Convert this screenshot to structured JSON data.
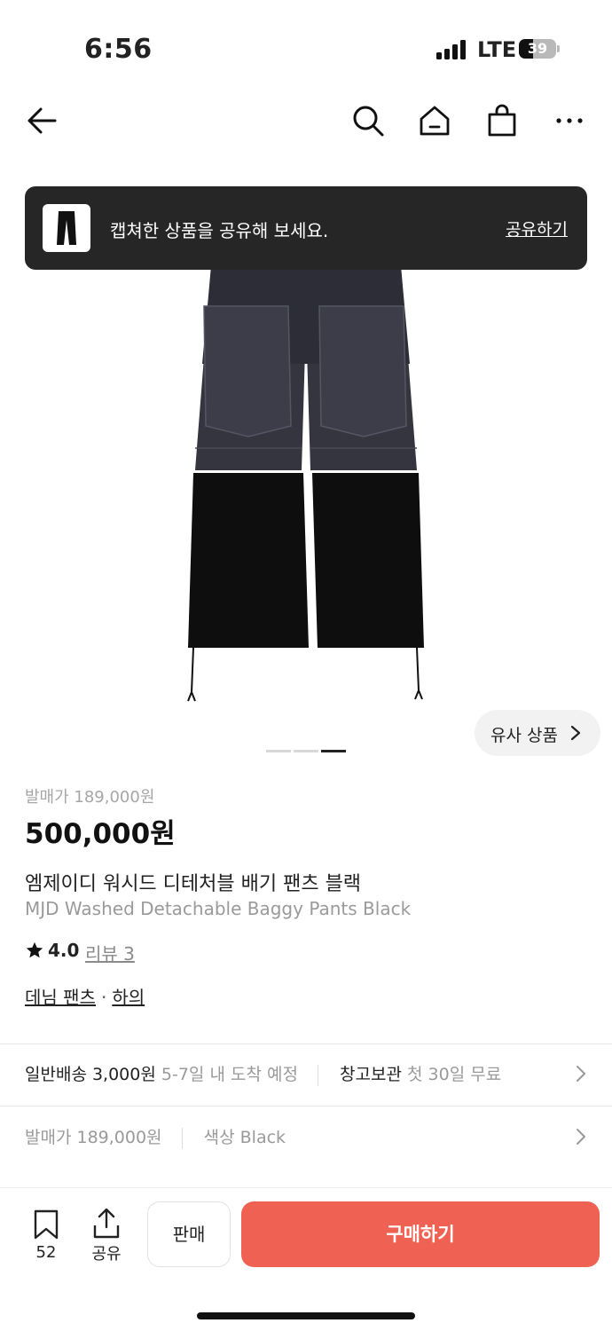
{
  "status_bar": {
    "time": "6:56",
    "network": "LTE",
    "battery": "39"
  },
  "nav": {
    "icons": [
      "back-arrow-icon",
      "search-icon",
      "home-icon",
      "shopping-bag-icon",
      "more-icon"
    ]
  },
  "toast": {
    "message": "캡쳐한 상품을 공유해 보세요.",
    "action": "공유하기"
  },
  "gallery": {
    "similar_label": "유사 상품",
    "page_count": 3,
    "active_page": 3
  },
  "product": {
    "release_price": "발매가 189,000원",
    "price": "500,000원",
    "name_ko": "엠제이디 워시드 디테처블 배기 팬츠 블랙",
    "name_en": "MJD Washed Detachable Baggy Pants Black",
    "rating": "4.0",
    "review": "리뷰 3",
    "categories": [
      "데님 팬츠",
      "하의"
    ]
  },
  "delivery": {
    "shipping": "일반배송 3,000원",
    "eta": "5-7일 내 도착 예정",
    "storage": "창고보관",
    "storage_note": "첫 30일 무료"
  },
  "options": {
    "release_price": "발매가 189,000원",
    "color": "색상 Black"
  },
  "bottom_bar": {
    "bookmark_count": "52",
    "share_label": "공유",
    "sell_label": "판매",
    "buy_label": "구매하기"
  },
  "colors": {
    "buy": "#ef6253",
    "toast_bg": "#262626",
    "accent_text": "#222222"
  }
}
